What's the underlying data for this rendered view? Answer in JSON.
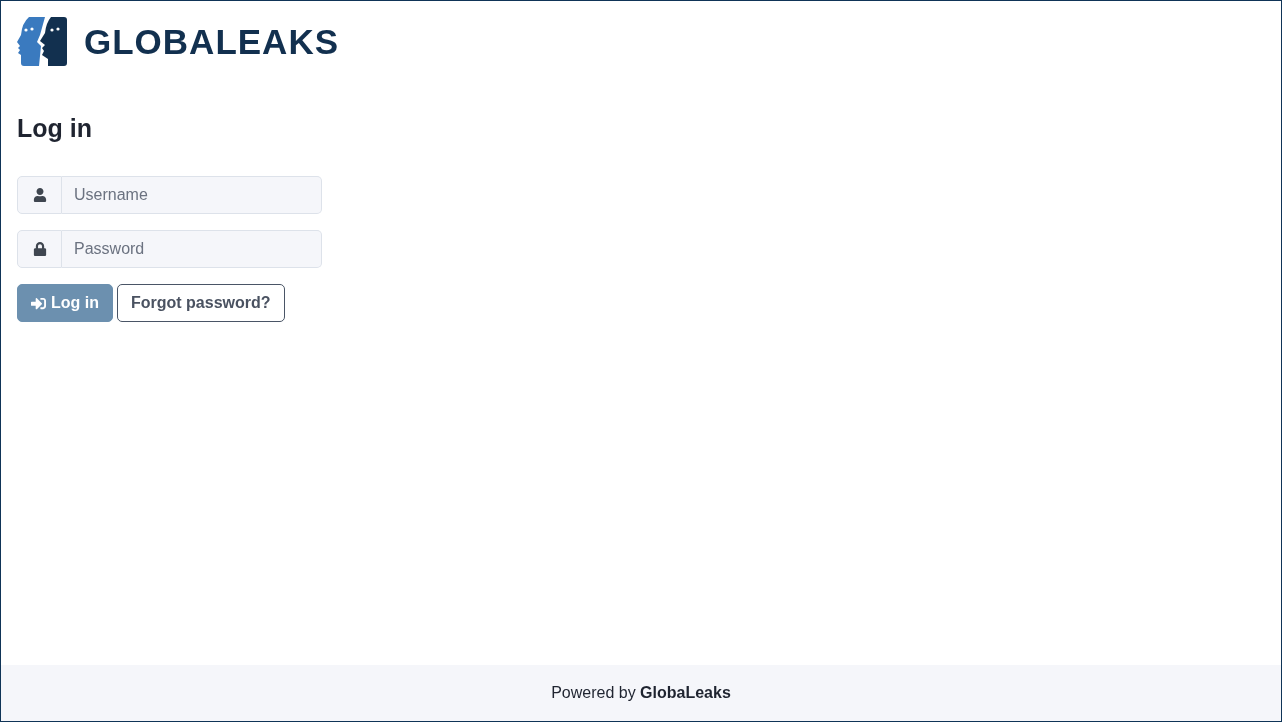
{
  "logo": {
    "text": "GLOBALEAKS"
  },
  "title": "Log in",
  "form": {
    "fields": [
      {
        "kind": "username",
        "placeholder": "Username"
      },
      {
        "kind": "password",
        "placeholder": "Password"
      }
    ],
    "buttons": [
      {
        "kind": "primary",
        "label": "Log in",
        "disabled": true
      },
      {
        "kind": "outline",
        "label": "Forgot password?",
        "disabled": false
      }
    ]
  },
  "footer": {
    "text": "Powered by **GlobaLeaks**"
  }
}
